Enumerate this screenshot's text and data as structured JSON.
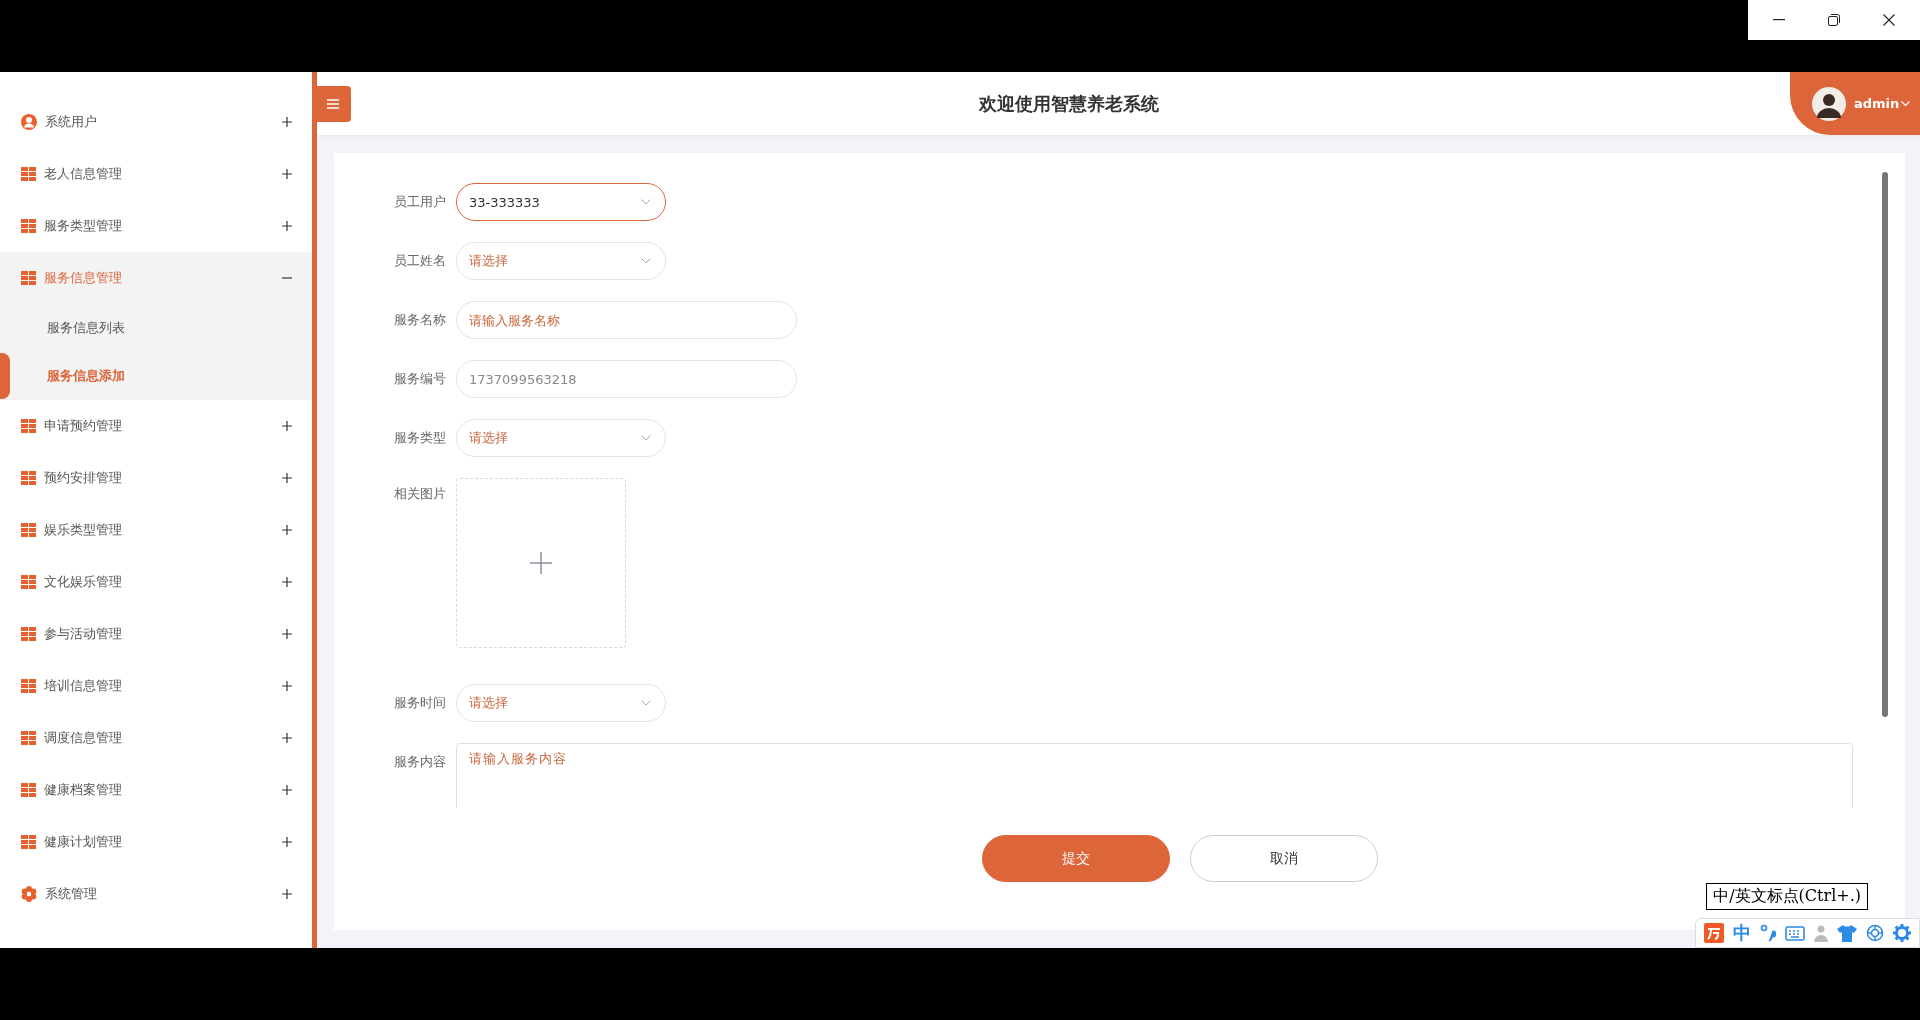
{
  "header": {
    "title": "欢迎使用智慧养老系统",
    "user": "admin"
  },
  "sidebar": {
    "items": [
      {
        "label": "系统用户",
        "kind": "user",
        "expanded": false
      },
      {
        "label": "老人信息管理",
        "kind": "grid",
        "expanded": false
      },
      {
        "label": "服务类型管理",
        "kind": "grid",
        "expanded": false
      },
      {
        "label": "服务信息管理",
        "kind": "grid",
        "expanded": true,
        "children": [
          {
            "label": "服务信息列表",
            "selected": false
          },
          {
            "label": "服务信息添加",
            "selected": true
          }
        ]
      },
      {
        "label": "申请预约管理",
        "kind": "grid",
        "expanded": false
      },
      {
        "label": "预约安排管理",
        "kind": "grid",
        "expanded": false
      },
      {
        "label": "娱乐类型管理",
        "kind": "grid",
        "expanded": false
      },
      {
        "label": "文化娱乐管理",
        "kind": "grid",
        "expanded": false
      },
      {
        "label": "参与活动管理",
        "kind": "grid",
        "expanded": false
      },
      {
        "label": "培训信息管理",
        "kind": "grid",
        "expanded": false
      },
      {
        "label": "调度信息管理",
        "kind": "grid",
        "expanded": false
      },
      {
        "label": "健康档案管理",
        "kind": "grid",
        "expanded": false
      },
      {
        "label": "健康计划管理",
        "kind": "grid",
        "expanded": false
      },
      {
        "label": "系统管理",
        "kind": "gear",
        "expanded": false
      }
    ]
  },
  "form": {
    "fields": [
      {
        "label": "员工用户",
        "kind": "select",
        "value": "33-333333",
        "focused": true
      },
      {
        "label": "员工姓名",
        "kind": "select",
        "placeholder": "请选择",
        "focused": false
      },
      {
        "label": "服务名称",
        "kind": "input",
        "placeholder": "请输入服务名称",
        "focused": false
      },
      {
        "label": "服务编号",
        "kind": "input",
        "value": "1737099563218",
        "focused": false
      },
      {
        "label": "服务类型",
        "kind": "select",
        "placeholder": "请选择",
        "focused": false
      },
      {
        "label": "相关图片",
        "kind": "upload",
        "focused": false
      },
      {
        "label": "服务时间",
        "kind": "select",
        "placeholder": "请选择",
        "focused": false
      },
      {
        "label": "服务内容",
        "kind": "textarea",
        "placeholder": "请输入服务内容",
        "focused": false
      }
    ],
    "buttons": [
      {
        "label": "提交",
        "kind": "primary"
      },
      {
        "label": "取消",
        "kind": "secondary"
      }
    ]
  },
  "ime": {
    "tooltip": "中/英文标点(Ctrl+.)",
    "mode": "中"
  }
}
